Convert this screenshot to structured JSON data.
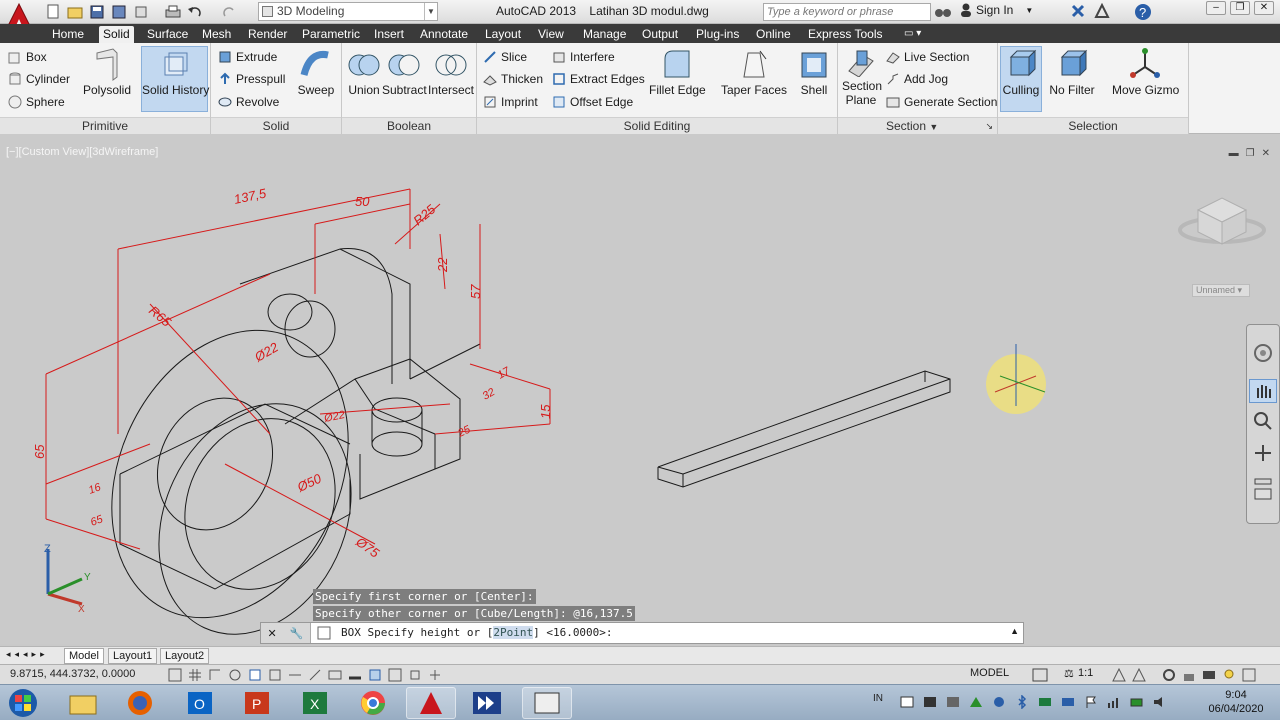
{
  "titlebar": {
    "workspace": "3D Modeling",
    "app_name": "AutoCAD 2013",
    "file_name": "Latihan 3D modul.dwg",
    "search_placeholder": "Type a keyword or phrase",
    "signin_label": "Sign In"
  },
  "ribbon_tabs": [
    "Home",
    "Solid",
    "Surface",
    "Mesh",
    "Render",
    "Parametric",
    "Insert",
    "Annotate",
    "Layout",
    "View",
    "Manage",
    "Output",
    "Plug-ins",
    "Online",
    "Express Tools"
  ],
  "active_tab": "Solid",
  "panels": {
    "primitive": {
      "title": "Primitive",
      "items": [
        "Box",
        "Cylinder",
        "Sphere"
      ],
      "polysolid": "Polysolid"
    },
    "solid": {
      "title": "Solid",
      "solid_history": "Solid History",
      "items": [
        "Extrude",
        "Presspull",
        "Revolve"
      ],
      "sweep": "Sweep"
    },
    "boolean": {
      "title": "Boolean",
      "items": [
        "Union",
        "Subtract",
        "Intersect"
      ]
    },
    "solid_editing": {
      "title": "Solid Editing",
      "col1": [
        "Slice",
        "Thicken",
        "Imprint"
      ],
      "col2": [
        "Interfere",
        "Extract Edges",
        "Offset Edge"
      ],
      "fillet_edge": "Fillet Edge",
      "taper_faces": "Taper Faces",
      "shell": "Shell"
    },
    "section": {
      "title": "Section",
      "section_plane": "Section Plane",
      "items": [
        "Live Section",
        "Add Jog",
        "Generate Section"
      ]
    },
    "selection": {
      "title": "Selection",
      "culling": "Culling",
      "no_filter": "No Filter",
      "move_gizmo": "Move Gizmo"
    }
  },
  "viewport": {
    "label": "[−][Custom View][3dWireframe]",
    "unnamed": "Unnamed",
    "dimensions": [
      "137,5",
      "50",
      "R25",
      "22",
      "57",
      "R65",
      "Ø22",
      "65",
      "Ø22",
      "32",
      "15",
      "25",
      "17",
      "Ø50",
      "Ø75",
      "16",
      "65"
    ]
  },
  "command": {
    "history": [
      "Specify first corner or [Center]:",
      "Specify other corner or [Cube/Length]: @16,137.5"
    ],
    "prefix": "BOX Specify height or [",
    "option": "2Point",
    "suffix": "] <16.0000>:"
  },
  "layout_tabs": [
    "Model",
    "Layout1",
    "Layout2"
  ],
  "statusbar": {
    "coords": "9.8715,   444.3732, 0.0000",
    "model": "MODEL",
    "scale": "1:1"
  },
  "taskbar": {
    "lang": "IN",
    "time": "9:04",
    "date": "06/04/2020"
  },
  "colors": {
    "dimension_red": "#d61a1a",
    "tab_bar": "#3a3a3a",
    "canvas": "#cacaca"
  }
}
